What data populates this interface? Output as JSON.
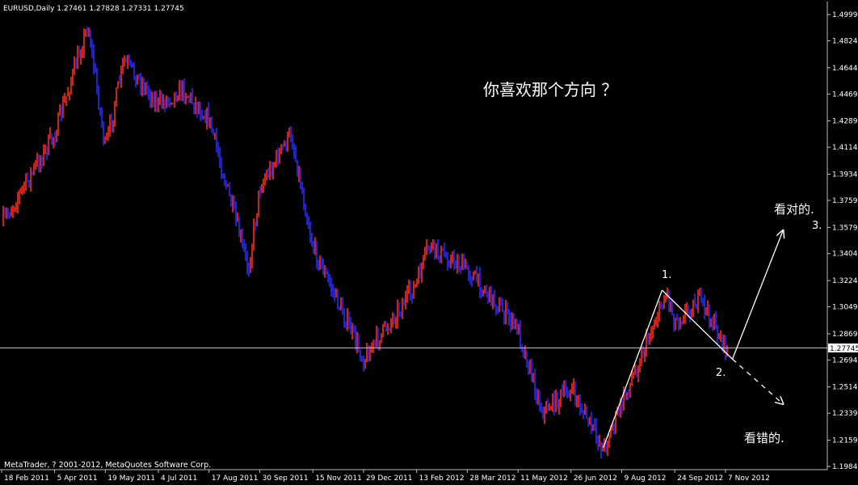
{
  "header": {
    "symbol_line": "EURUSD,Daily  1.27461 1.27828 1.27331 1.27745"
  },
  "footer": {
    "copyright": "MetaTrader, ? 2001-2012, MetaQuotes Software Corp."
  },
  "annotations": {
    "question": "你喜欢那个方向 ？",
    "label_1": "1.",
    "label_2": "2.",
    "label_3": "3.",
    "right_text": "看对的.",
    "wrong_text": "看错的."
  },
  "colors": {
    "background": "#000000",
    "up_bar": "#ff2a1a",
    "down_bar": "#2a2aff",
    "text": "#ffffff",
    "grid_line": "#c0c0c0"
  },
  "chart_data": {
    "type": "ohlc",
    "symbol": "EURUSD",
    "timeframe": "Daily",
    "last_bar": {
      "open": 1.27461,
      "high": 1.27828,
      "low": 1.27331,
      "close": 1.27745
    },
    "current_price": "1.27745",
    "ylim": [
      1.1984,
      1.4999
    ],
    "y_ticks": [
      "1.49990",
      "1.48240",
      "1.46440",
      "1.44690",
      "1.42890",
      "1.41140",
      "1.39340",
      "1.37590",
      "1.35790",
      "1.34040",
      "1.32240",
      "1.30490",
      "1.28690",
      "1.26940",
      "1.25140",
      "1.23390",
      "1.21590",
      "1.19840"
    ],
    "x_ticks": [
      "18 Feb 2011",
      "5 Apr 2011",
      "19 May 2011",
      "4 Jul 2011",
      "17 Aug 2011",
      "30 Sep 2011",
      "15 Nov 2011",
      "29 Dec 2011",
      "13 Feb 2012",
      "28 Mar 2012",
      "11 May 2012",
      "26 Jun 2012",
      "9 Aug 2012",
      "24 Sep 2012",
      "7 Nov 2012"
    ],
    "price_path": [
      {
        "date": "18 Feb 2011",
        "price": 1.36
      },
      {
        "date": "5 Apr 2011",
        "price": 1.42
      },
      {
        "date": "4 May 2011",
        "price": 1.493
      },
      {
        "date": "19 May 2011",
        "price": 1.41
      },
      {
        "date": "4 Jun 2011",
        "price": 1.469
      },
      {
        "date": "4 Jul 2011",
        "price": 1.44
      },
      {
        "date": "25 Jul 2011",
        "price": 1.45
      },
      {
        "date": "17 Aug 2011",
        "price": 1.43
      },
      {
        "date": "8 Sep 2011",
        "price": 1.365
      },
      {
        "date": "20 Sep 2011",
        "price": 1.33
      },
      {
        "date": "30 Sep 2011",
        "price": 1.385
      },
      {
        "date": "27 Oct 2011",
        "price": 1.42
      },
      {
        "date": "15 Nov 2011",
        "price": 1.345
      },
      {
        "date": "29 Dec 2011",
        "price": 1.27
      },
      {
        "date": "13 Feb 2012",
        "price": 1.32
      },
      {
        "date": "23 Feb 2012",
        "price": 1.345
      },
      {
        "date": "28 Mar 2012",
        "price": 1.33
      },
      {
        "date": "11 May 2012",
        "price": 1.29
      },
      {
        "date": "1 Jun 2012",
        "price": 1.235
      },
      {
        "date": "26 Jun 2012",
        "price": 1.25
      },
      {
        "date": "24 Jul 2012",
        "price": 1.21
      },
      {
        "date": "9 Aug 2012",
        "price": 1.24
      },
      {
        "date": "17 Sep 2012",
        "price": 1.315
      },
      {
        "date": "24 Sep 2012",
        "price": 1.295
      },
      {
        "date": "16 Oct 2012",
        "price": 1.31
      },
      {
        "date": "7 Nov 2012",
        "price": 1.2775
      }
    ],
    "drawn_lines": [
      {
        "from": {
          "date": "24 Jul 2012",
          "price": 1.211
        },
        "to": {
          "date": "13 Sep 2012",
          "price": 1.316
        }
      },
      {
        "from": {
          "date": "13 Sep 2012",
          "price": 1.316
        },
        "to": {
          "date": "13 Nov 2012",
          "price": 1.27
        }
      },
      {
        "from": {
          "date": "13 Nov 2012",
          "price": 1.27
        },
        "to": {
          "date": "27 Dec 2012",
          "price": 1.356
        },
        "arrow": true
      },
      {
        "from": {
          "date": "13 Nov 2012",
          "price": 1.27
        },
        "to": {
          "date": "27 Dec 2012",
          "price": 1.24
        },
        "arrow": true,
        "dashed": true
      }
    ]
  }
}
